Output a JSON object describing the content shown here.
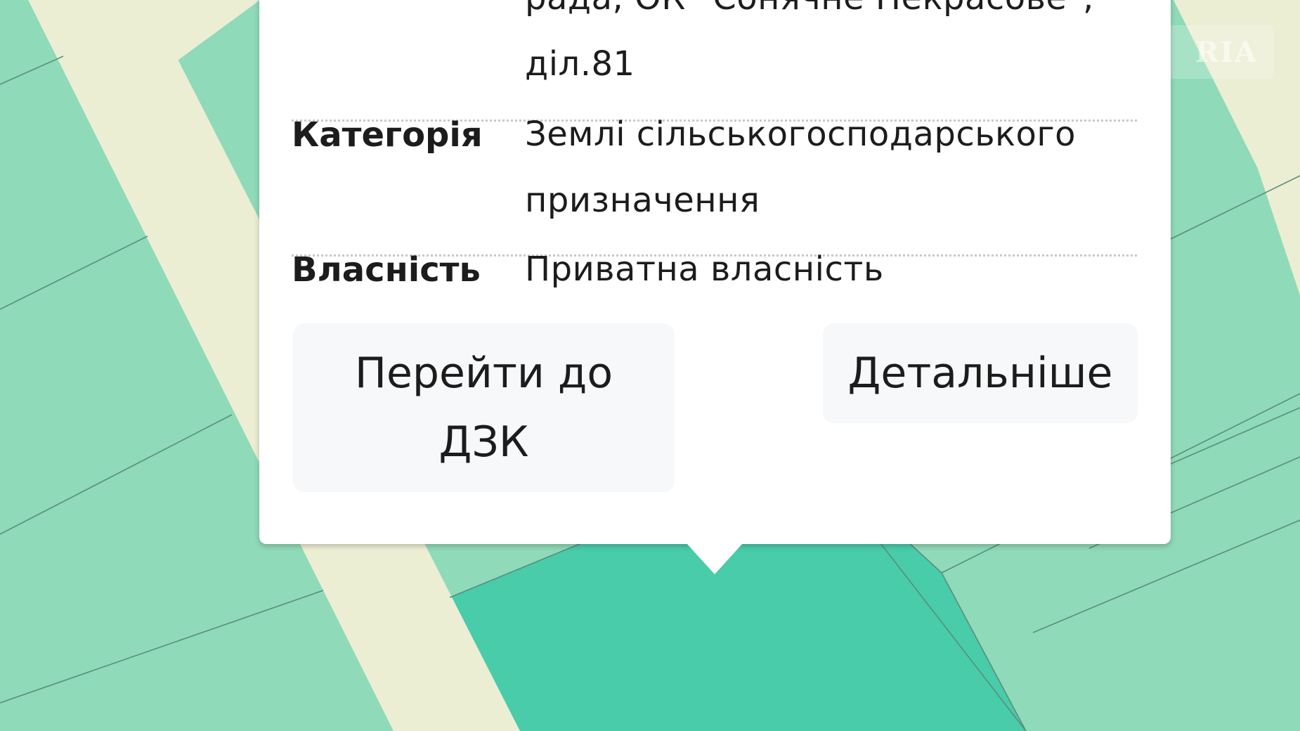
{
  "watermark": {
    "text": "RIA"
  },
  "popup": {
    "address_value": "рада, ОК \"Сонячне Некрасове\", діл.81",
    "rows": [
      {
        "label": "Категорія",
        "value": "Землі сільськогосподарського призначення"
      },
      {
        "label": "Власність",
        "value": "Приватна власність"
      }
    ],
    "buttons": {
      "go_dzk": "Перейти до ДЗК",
      "details": "Детальніше"
    }
  },
  "map": {
    "colors": {
      "parcel": "#8fdab8",
      "parcel_selected": "#48ccaa",
      "road": "#eceed3",
      "boundary": "#5a8f7a"
    }
  }
}
